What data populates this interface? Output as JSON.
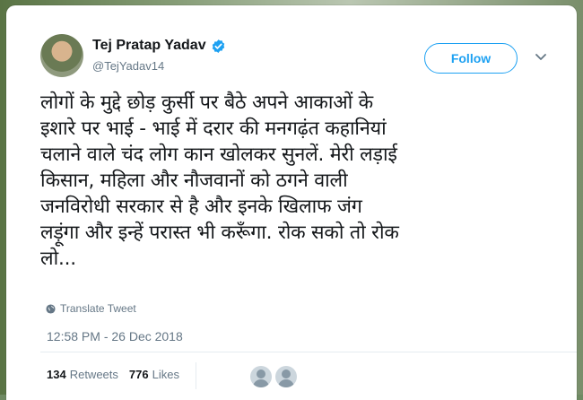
{
  "author": {
    "display_name": "Tej Pratap Yadav",
    "handle": "@TejYadav14",
    "verified": true
  },
  "follow_label": "Follow",
  "tweet": {
    "lines": [
      "लोगों के मुद्दे छोड़ कुर्सी पर बैठे अपने आकाओं के",
      "इशारे पर भाई - भाई में दरार की मनगढ़ंत कहानियां",
      "चलाने वाले चंद लोग कान खोलकर सुनलें. मेरी लड़ाई",
      "किसान, महिला और नौजवानों को ठगने वाली",
      "जनविरोधी सरकार से है और इनके खिलाफ जंग",
      "लड़ूंगा और इन्हें परास्त भी करूँगा. रोक सको तो रोक",
      "लो..."
    ],
    "translate_label": "Translate Tweet",
    "timestamp": "12:58 PM - 26 Dec 2018"
  },
  "stats": {
    "retweets_count": "134",
    "retweets_label": "Retweets",
    "likes_count": "776",
    "likes_label": "Likes"
  },
  "icons": [
    "verified-badge-icon",
    "chevron-down-icon",
    "globe-icon"
  ],
  "colors": {
    "accent": "#1da1f2",
    "secondary_text": "#657786",
    "primary_text": "#14171a"
  }
}
